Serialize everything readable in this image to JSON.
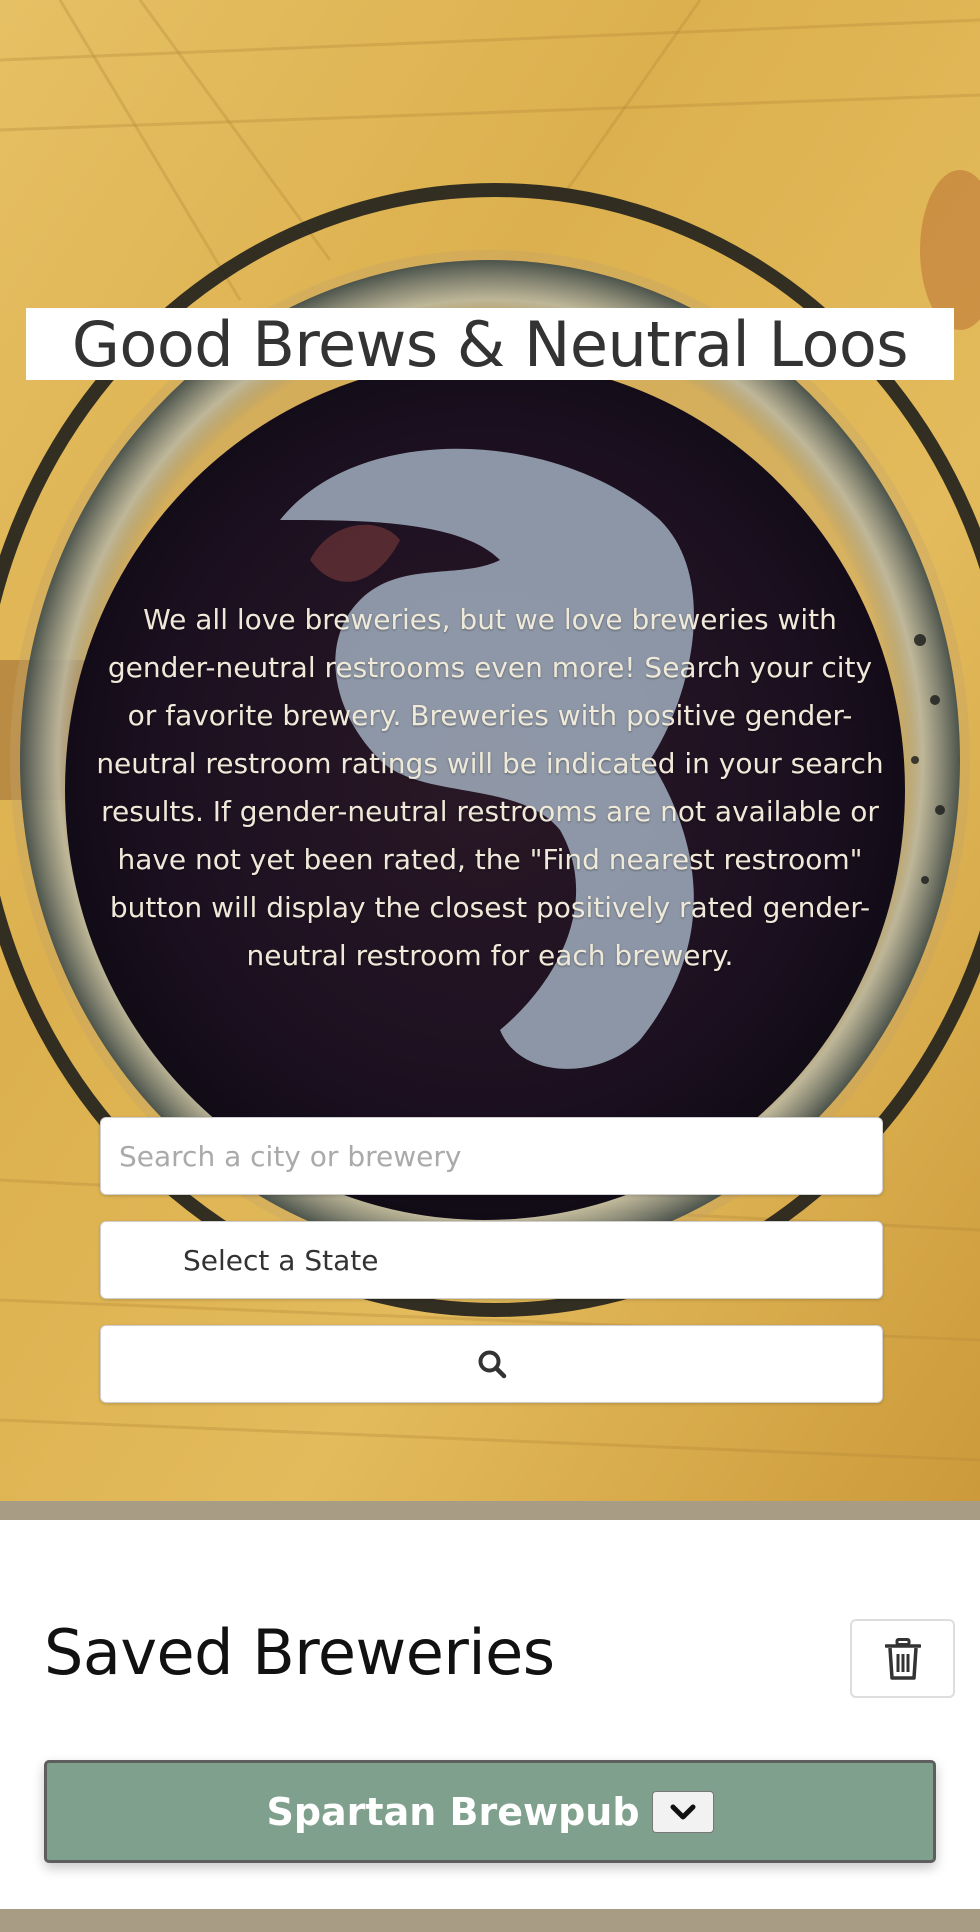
{
  "header": {
    "title": "Good Brews & Neutral Loos",
    "intro": "We all love breweries, but we love breweries with gender-neutral restrooms even more! Search your city or favorite brewery. Breweries with positive gender-neutral restroom ratings will be indicated in your search results. If gender-neutral restrooms are not available or have not yet been rated, the \"Find nearest restroom\" button will display the closest positively rated gender-neutral restroom for each brewery."
  },
  "search": {
    "placeholder": "Search a city or brewery",
    "value": "",
    "state_select_label": "Select a State",
    "button_icon": "search-icon"
  },
  "saved": {
    "title": "Saved Breweries",
    "clear_icon": "trash-icon",
    "breweries": [
      {
        "name": "Spartan Brewpub",
        "expand_icon": "chevron-down-icon"
      }
    ]
  },
  "colors": {
    "card_green": "#7fa08c",
    "band_tan": "#a89c84",
    "title_text": "#333333"
  }
}
